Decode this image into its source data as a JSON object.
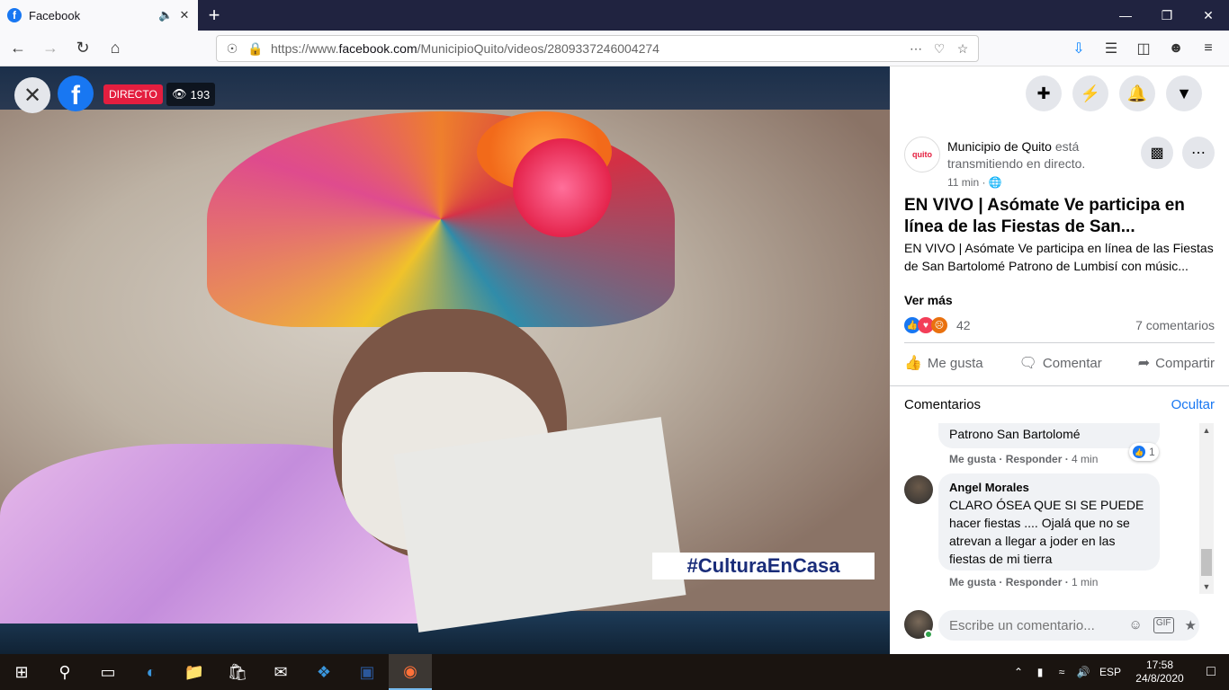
{
  "browser": {
    "tab_title": "Facebook",
    "tab_favicon": "f",
    "new_tab": "+",
    "url_prefix": "https://www.",
    "url_domain": "facebook.com",
    "url_path": "/MunicipioQuito/videos/2809337246004274"
  },
  "video": {
    "live_label": "DIRECTO",
    "viewers": "193",
    "hashtag": "#CulturaEnCasa",
    "fb_logo": "f"
  },
  "post": {
    "page_avatar_text": "quito",
    "page_name": "Municipio de Quito",
    "status": " está transmitiendo en directo.",
    "time": "11 min · ",
    "title": "EN VIVO | Asómate Ve participa en línea de las Fiestas de San...",
    "description": "EN VIVO | Asómate Ve participa en línea de las Fiestas de San Bartolomé Patrono de Lumbisí con músic...",
    "see_more": "Ver más",
    "reactions_count": "42",
    "comments_count": "7 comentarios",
    "like_label": "Me gusta",
    "comment_label": "Comentar",
    "share_label": "Compartir"
  },
  "comments": {
    "header": "Comentarios",
    "hide": "Ocultar",
    "items": [
      {
        "text": "Patrono San Bartolomé",
        "likes": "1",
        "like": "Me gusta",
        "reply": "Responder",
        "time": "4 min"
      },
      {
        "author": "Angel Morales",
        "text": "CLARO ÓSEA QUE SI SE PUEDE hacer fiestas .... Ojalá que no se atrevan a llegar a joder en las fiestas de mi tierra",
        "like": "Me gusta",
        "reply": "Responder",
        "time": "1 min"
      }
    ],
    "input_placeholder": "Escribe un comentario..."
  },
  "taskbar": {
    "lang": "ESP",
    "time": "17:58",
    "date": "24/8/2020"
  },
  "colors": {
    "facebook_blue": "#1877f2",
    "live_red": "#e41e3f",
    "hashtag_blue": "#1a2d7a"
  }
}
